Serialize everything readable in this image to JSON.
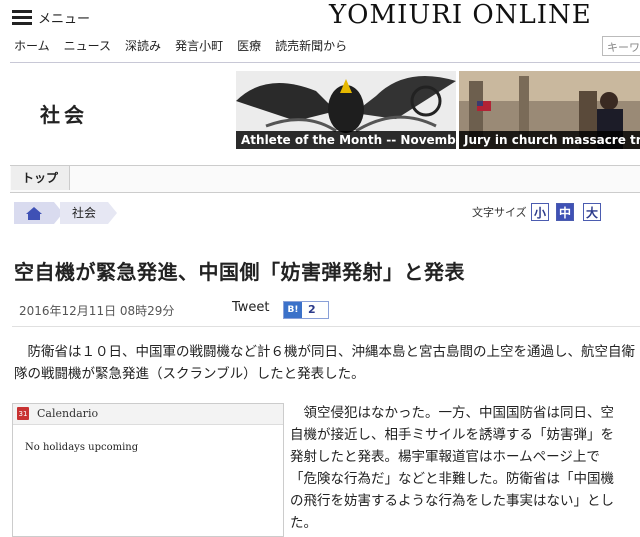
{
  "header": {
    "menu_label": "メニュー",
    "brand": "YOMIURI ONLINE",
    "nav": [
      "ホーム",
      "ニュース",
      "深読み",
      "発言小町",
      "医療",
      "読売新聞から"
    ],
    "search_placeholder": "キーワ"
  },
  "section": {
    "title": "社会"
  },
  "banners": [
    {
      "caption": "Athlete of the Month -- November"
    },
    {
      "caption": "Jury in church massacre trial watches Dylann Roof's confess"
    }
  ],
  "tabs": {
    "top": "トップ"
  },
  "breadcrumb": {
    "section": "社会"
  },
  "font_size": {
    "label": "文字サイズ",
    "small": "小",
    "medium": "中",
    "large": "大"
  },
  "article": {
    "headline": "空自機が緊急発進、中国側「妨害弾発射」と発表",
    "date": "2016年12月11日 08時29分",
    "tweet": "Tweet",
    "hatena_count": "2",
    "para1": "防衛省は１０日、中国軍の戦闘機など計６機が同日、沖縄本島と宮古島間の上空を通過し、航空自衛隊の戦闘機が緊急発進（スクランブル）したと発表した。",
    "para2": "領空侵犯はなかった。一方、中国国防省は同日、空自機が接近し、相手ミサイルを誘導する「妨害弾」を発射したと発表。楊宇軍報道官はホームページ上で「危険な行為だ」などと非難した。防衛省は「中国機の飛行を妨害するような行為をした事実はない」とした。"
  },
  "calendar": {
    "title": "Calendario",
    "message": "No holidays upcoming"
  }
}
